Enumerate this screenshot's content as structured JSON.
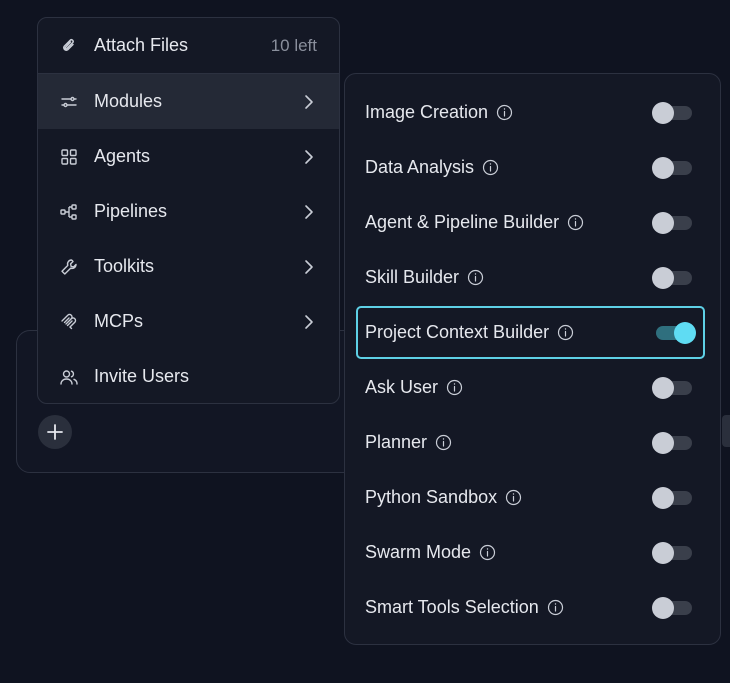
{
  "colors": {
    "background": "#0f1320",
    "panel": "#141825",
    "active_item": "#242936",
    "accent": "#5ed0e6",
    "toggle_off_knob": "#c9cdd6",
    "toggle_on_knob": "#5fdcf3"
  },
  "menu": {
    "items": [
      {
        "label": "Attach Files",
        "meta": "10 left",
        "icon": "paperclip-icon"
      },
      {
        "label": "Modules",
        "icon": "sliders-icon",
        "active": true
      },
      {
        "label": "Agents",
        "icon": "grid-icon"
      },
      {
        "label": "Pipelines",
        "icon": "pipeline-icon"
      },
      {
        "label": "Toolkits",
        "icon": "wrench-icon"
      },
      {
        "label": "MCPs",
        "icon": "mcp-icon"
      },
      {
        "label": "Invite Users",
        "icon": "users-icon"
      }
    ]
  },
  "modules": {
    "items": [
      {
        "label": "Image Creation",
        "enabled": false
      },
      {
        "label": "Data Analysis",
        "enabled": false
      },
      {
        "label": "Agent & Pipeline Builder",
        "enabled": false
      },
      {
        "label": "Skill Builder",
        "enabled": false
      },
      {
        "label": "Project Context Builder",
        "enabled": true
      },
      {
        "label": "Ask User",
        "enabled": false
      },
      {
        "label": "Planner",
        "enabled": false
      },
      {
        "label": "Python Sandbox",
        "enabled": false
      },
      {
        "label": "Swarm Mode",
        "enabled": false
      },
      {
        "label": "Smart Tools Selection",
        "enabled": false
      }
    ]
  }
}
